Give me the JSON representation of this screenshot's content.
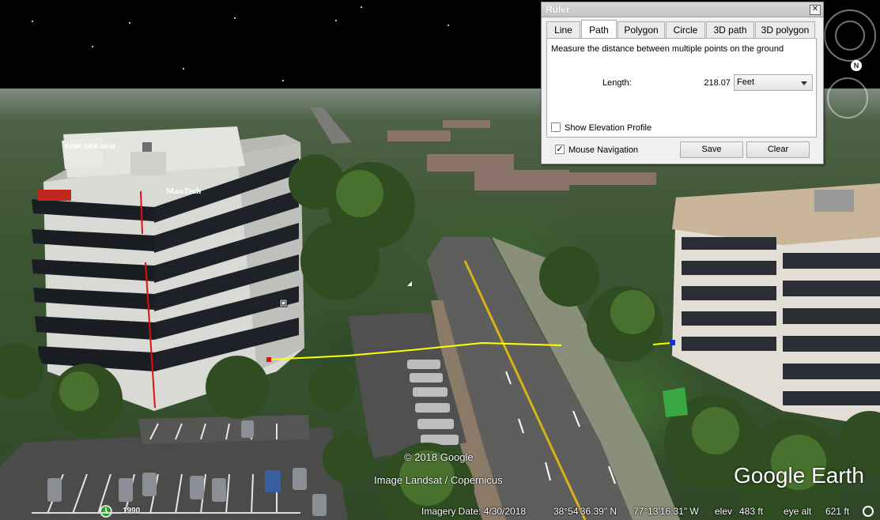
{
  "ruler": {
    "title": "Ruler",
    "close_glyph": "✕",
    "tabs": [
      {
        "label": "Line",
        "active": false
      },
      {
        "label": "Path",
        "active": true
      },
      {
        "label": "Polygon",
        "active": false
      },
      {
        "label": "Circle",
        "active": false
      },
      {
        "label": "3D path",
        "active": false
      },
      {
        "label": "3D polygon",
        "active": false
      }
    ],
    "description": "Measure the distance between multiple points on the ground",
    "length_label": "Length:",
    "length_value": "218.07",
    "unit": "Feet",
    "show_elevation_label": "Show Elevation Profile",
    "show_elevation_checked": false,
    "mouse_nav_label": "Mouse Navigation",
    "mouse_nav_checked": true,
    "check_glyph": "✓",
    "save_label": "Save",
    "clear_label": "Clear"
  },
  "map": {
    "copyright": "© 2018 Google",
    "imagery_source": "Image Landsat / Copernicus",
    "logo": "Google Earth",
    "sign_left": "ManTech",
    "sign_top": "PARK SIDE NEW",
    "path_color": "#ffff00",
    "vertical_marker_color": "#e01010"
  },
  "status": {
    "historical_year": "1990",
    "imagery_date": "Imagery Date: 4/30/2018",
    "latitude": "38°54'36.39\" N",
    "longitude": "77°13'16.31\" W",
    "elev_label": "elev",
    "elev_value": "483 ft",
    "eye_alt_label": "eye alt",
    "eye_alt_value": "621 ft"
  }
}
